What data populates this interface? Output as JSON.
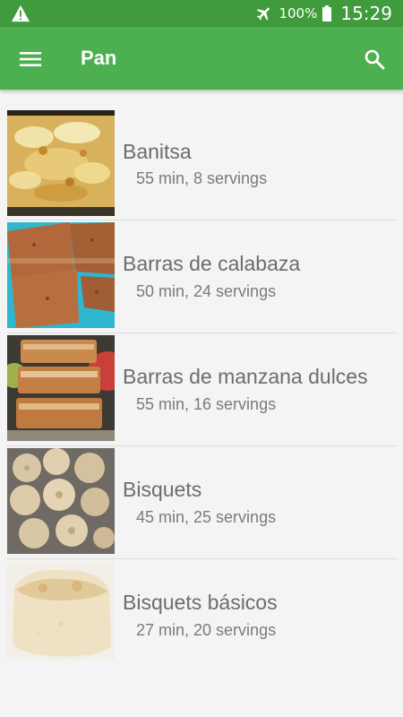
{
  "status_bar": {
    "battery_percent": "100%",
    "time": "15:29",
    "icons": [
      "warning-icon",
      "airplane-mode-icon",
      "battery-full-icon"
    ]
  },
  "app_bar": {
    "title": "Pan",
    "icons": [
      "menu-icon",
      "search-icon"
    ],
    "color": "#4caf50",
    "status_color": "#3f9b3b"
  },
  "recipes": [
    {
      "name": "Banitsa",
      "meta": "55 min, 8 servings",
      "image": "baked-banitsa-pastry"
    },
    {
      "name": "Barras de calabaza",
      "meta": "50 min, 24 servings",
      "image": "pumpkin-bars"
    },
    {
      "name": "Barras de manzana dulces",
      "meta": "55 min, 16 servings",
      "image": "apple-bars-stack"
    },
    {
      "name": "Bisquets",
      "meta": "45 min, 25 servings",
      "image": "round-biscuits-pile"
    },
    {
      "name": "Bisquets básicos",
      "meta": "27 min, 20 servings",
      "image": "single-biscuit"
    }
  ]
}
